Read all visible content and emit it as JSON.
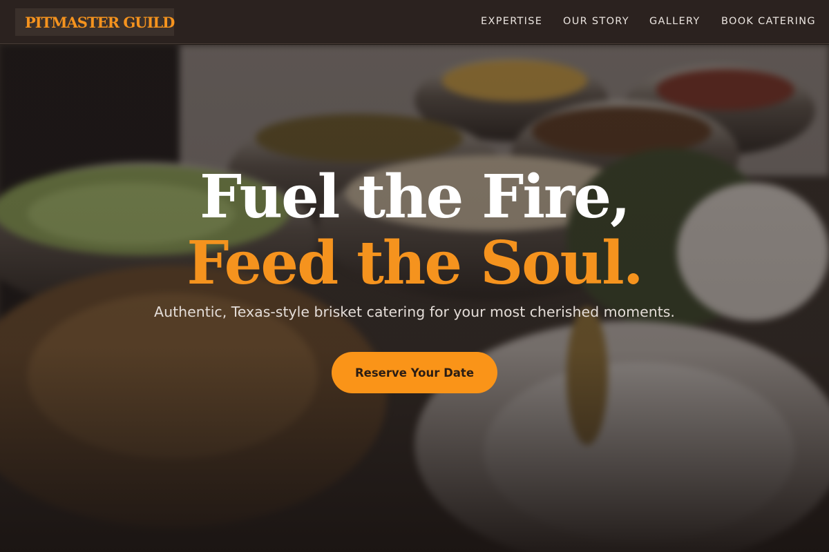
{
  "brand": {
    "name": "PITMASTER GUILD",
    "accent_color": "#f5931e"
  },
  "nav": {
    "links": [
      "EXPERTISE",
      "OUR STORY",
      "GALLERY",
      "BOOK CATERING"
    ]
  },
  "hero": {
    "headline_line1": "Fuel the Fire,",
    "headline_line2": "Feed the Soul.",
    "subtitle": "Authentic, Texas-style brisket catering for your most cherished moments.",
    "cta_label": "Reserve Your Date",
    "background_image": "blurred catering buffet with chafing dishes, salad, and white flowers"
  }
}
